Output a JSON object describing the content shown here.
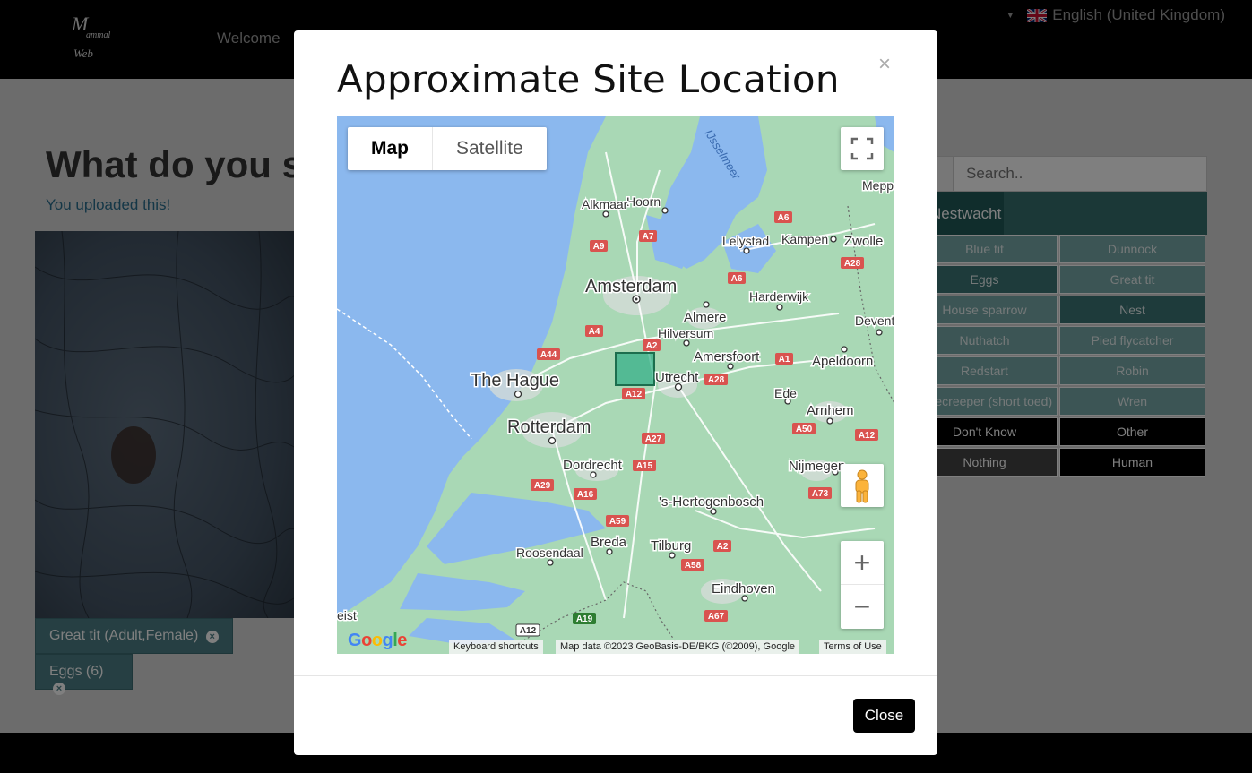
{
  "header": {
    "logo_text": "Mammal Web",
    "nav": {
      "welcome": "Welcome"
    },
    "language": "English (United Kingdom)"
  },
  "main": {
    "title": "What do you se",
    "uploaded": "You uploaded this!",
    "tags": [
      {
        "label": "Great tit (Adult,Female)"
      },
      {
        "label": "Eggs (6)"
      }
    ]
  },
  "species_panel": {
    "search_placeholder": "Search..",
    "category_tab": "Nestwacht",
    "species": [
      "Blue tit",
      "Dunnock",
      "Eggs",
      "Great tit",
      "House sparrow",
      "Nest",
      "Nuthatch",
      "Pied flycatcher",
      "Redstart",
      "Robin",
      "Treecreeper (short toed)",
      "Wren"
    ],
    "specials": [
      "Don't Know",
      "Other",
      "Nothing",
      "Human"
    ]
  },
  "modal": {
    "title": "Approximate Site Location",
    "close_x": "×",
    "close_button": "Close",
    "map": {
      "type_map": "Map",
      "type_satellite": "Satellite",
      "zoom_in": "+",
      "zoom_out": "−",
      "attribution_shortcuts": "Keyboard shortcuts",
      "attribution_data": "Map data ©2023 GeoBasis-DE/BKG (©2009), Google",
      "attribution_terms": "Terms of Use",
      "google": "Google",
      "places": {
        "amsterdam": "Amsterdam",
        "the_hague": "The Hague",
        "rotterdam": "Rotterdam",
        "utrecht": "Utrecht",
        "hoorn": "Hoorn",
        "alkmaar": "Alkmaar",
        "lelystad": "Lelystad",
        "kampen": "Kampen",
        "zwolle": "Zwolle",
        "almere": "Almere",
        "hilversum": "Hilversum",
        "harderwijk": "Harderwijk",
        "amersfoort": "Amersfoort",
        "apeldoorn": "Apeldoorn",
        "deventer": "Devent",
        "meppel": "Mepp",
        "ede": "Ede",
        "arnhem": "Arnhem",
        "nijmegen": "Nijmegen",
        "dordrecht": "Dordrecht",
        "den_bosch": "'s-Hertogenbosch",
        "breda": "Breda",
        "tilburg": "Tilburg",
        "roosendaal": "Roosendaal",
        "eindhoven": "Eindhoven",
        "ijsselmeer": "IJsselmeer",
        "eist": "eist"
      },
      "roads": [
        "A6",
        "A7",
        "A9",
        "A28",
        "A6",
        "A4",
        "A2",
        "A44",
        "A1",
        "A28",
        "A12",
        "A50",
        "A12",
        "A27",
        "A15",
        "A29",
        "A16",
        "A73",
        "A59",
        "A2",
        "A58",
        "A67",
        "A19",
        "A12"
      ]
    }
  },
  "colors": {
    "site_marker": "#2fae86",
    "tag_bg": "#4c7f86",
    "category_tab": "#215a59"
  }
}
